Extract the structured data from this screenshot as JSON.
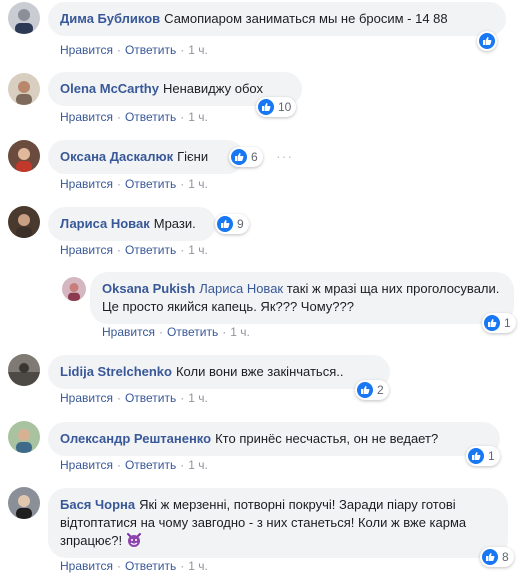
{
  "actions": {
    "like": "Нравится",
    "reply": "Ответить",
    "separator": "·",
    "time": "1 ч."
  },
  "colors": {
    "link": "#385898",
    "bubble": "#f2f3f5",
    "like_blue": "#1877f2",
    "meta": "#90949c"
  },
  "comments": [
    {
      "author": "Дима Бубликов",
      "text": "Самопиаром заниматься мы не бросим - 14 88",
      "reactions": ""
    },
    {
      "author": "Olena McCarthy",
      "text": "Ненавиджу обох",
      "reactions": "10"
    },
    {
      "author": "Оксана Даскалюк",
      "text": "Гієни",
      "reactions": "6"
    },
    {
      "author": "Лариса Новак",
      "text": "Мрази.",
      "reactions": "9"
    },
    {
      "author": "Oksana Pukish",
      "mention": "Лариса Новак",
      "text": "такі ж мразі ща них проголосували. Це просто якийся капець. Як??? Чому???",
      "reactions": "1"
    },
    {
      "author": "Lidija Strelchenko",
      "text": "Коли вони вже закінчаться..",
      "reactions": "2"
    },
    {
      "author": "Олександр Рештаненко",
      "text": "Кто принёс несчастья, он не ведает?",
      "reactions": "1"
    },
    {
      "author": "Бася Чорна",
      "text": "Які ж мерзенні, потворні покручі! Заради піару готові відтоптатися на чому завгодно - з них станеться! Коли ж вже карма зпрацює?!",
      "reactions": "8"
    }
  ]
}
